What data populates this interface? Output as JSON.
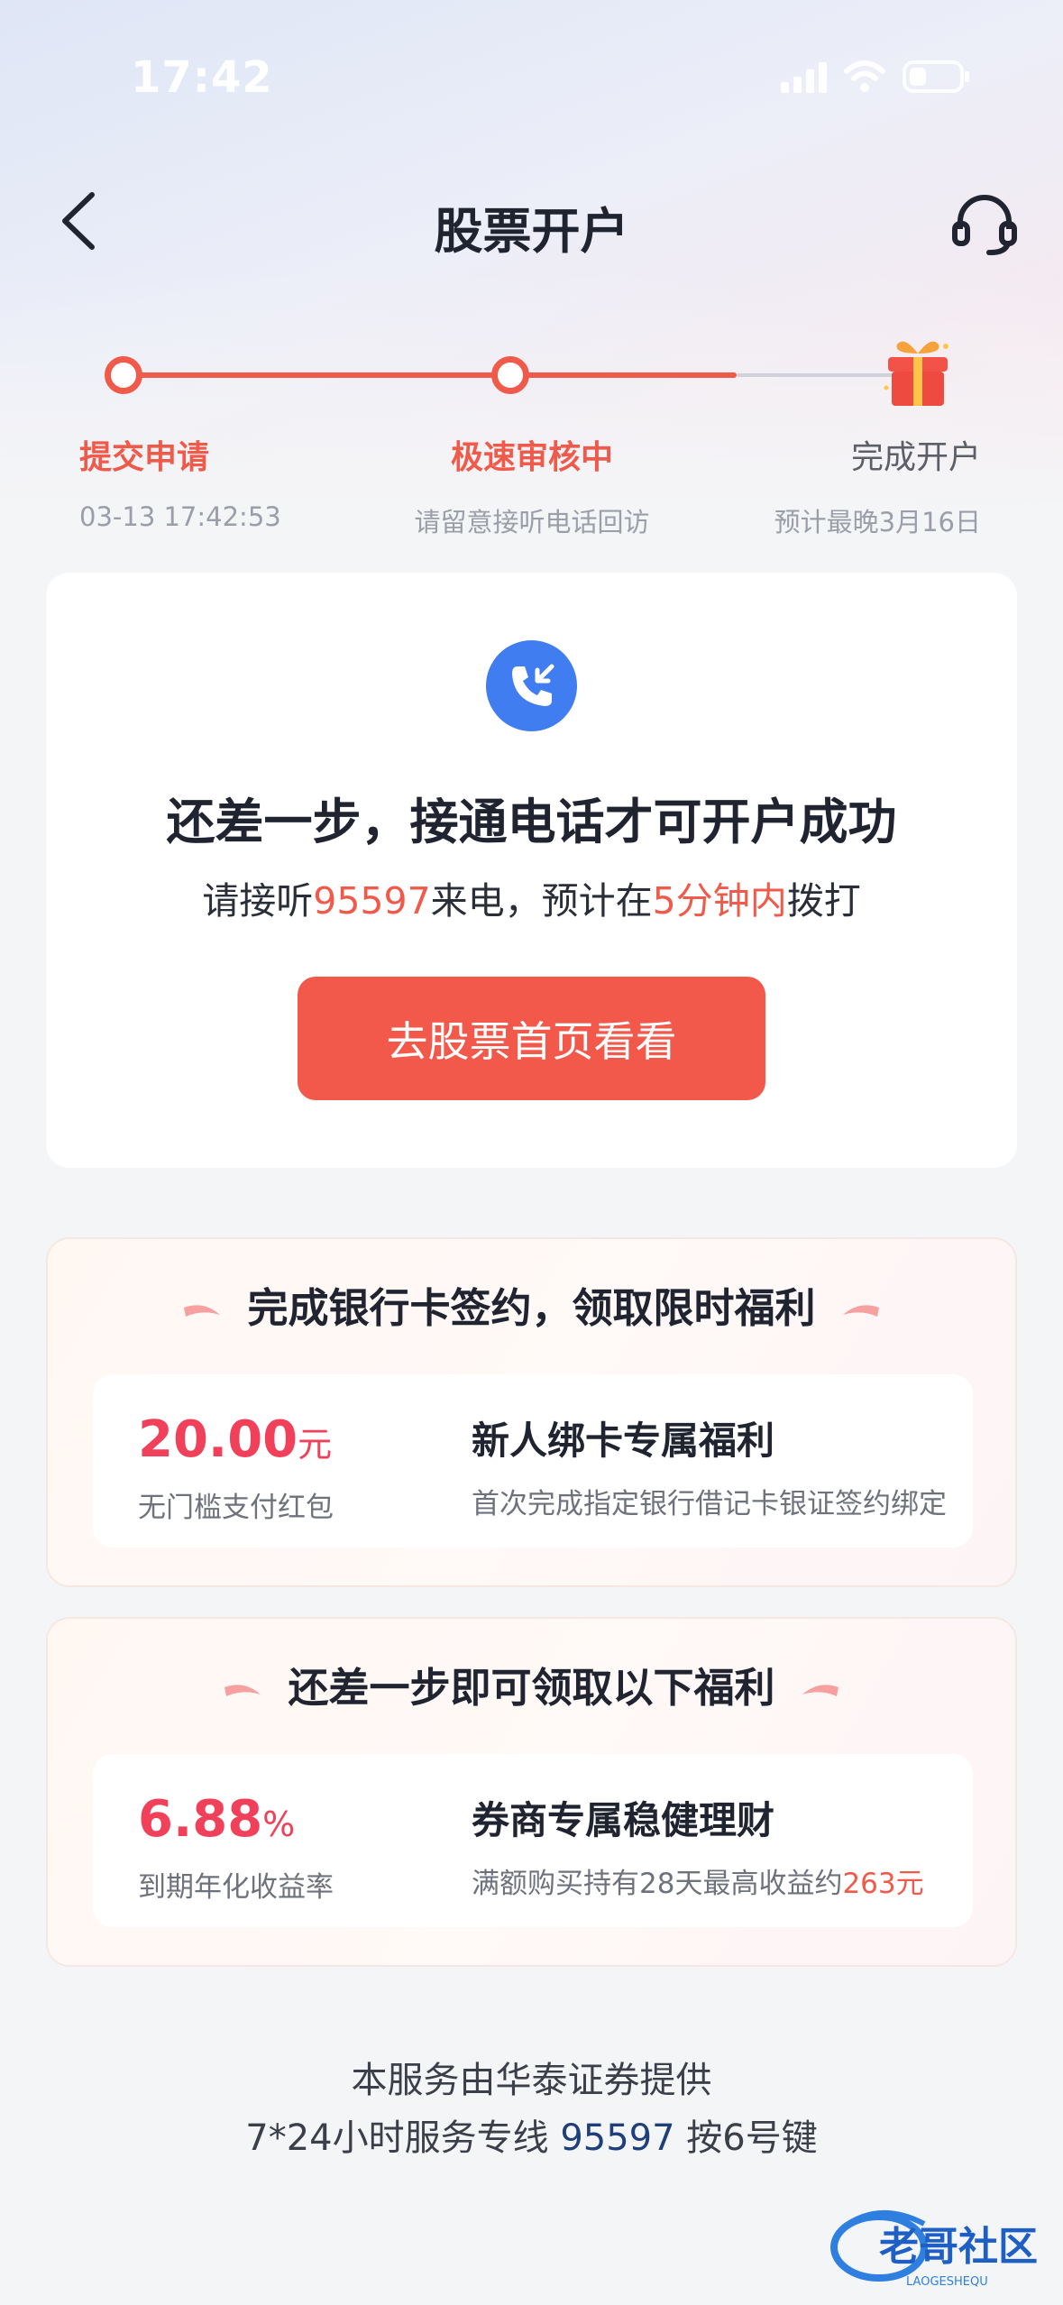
{
  "status": {
    "time": "17:42"
  },
  "nav": {
    "title": "股票开户"
  },
  "progress": {
    "steps": [
      {
        "label": "提交申请",
        "sub": "03-13 17:42:53"
      },
      {
        "label": "极速审核中",
        "sub": "请留意接听电话回访"
      },
      {
        "label": "完成开户",
        "sub": "预计最晚3月16日"
      }
    ]
  },
  "main": {
    "headline": "还差一步，接通电话才可开户成功",
    "sub_pre": "请接听",
    "sub_number": "95597",
    "sub_mid": "来电，预计在",
    "sub_time": "5分钟内",
    "sub_post": "拨打",
    "button": "去股票首页看看"
  },
  "benefit1": {
    "heading": "完成银行卡签约，领取限时福利",
    "amount": "20.00",
    "unit": "元",
    "amount_desc": "无门槛支付红包",
    "title": "新人绑卡专属福利",
    "desc": "首次完成指定银行借记卡银证签约绑定"
  },
  "benefit2": {
    "heading": "还差一步即可领取以下福利",
    "amount": "6.88",
    "unit": "%",
    "amount_desc": "到期年化收益率",
    "title": "券商专属稳健理财",
    "desc_pre": "满额购买持有28天最高收益约",
    "desc_highlight": "263元"
  },
  "footer": {
    "line1": "本服务由华泰证券提供",
    "line2_pre": "7*24小时服务专线",
    "hotline": "95597",
    "line2_post": "按6号键"
  },
  "watermark": {
    "text": "老哥社区",
    "sub": "LAOGESHEQU"
  },
  "colors": {
    "accent": "#f05a4a",
    "primary_button": "#f2594b",
    "phone_icon_bg": "#3f7df0",
    "amount": "#f0405a"
  },
  "icons": [
    "chevron-left-icon",
    "headset-icon",
    "gift-icon",
    "phone-incoming-icon"
  ]
}
